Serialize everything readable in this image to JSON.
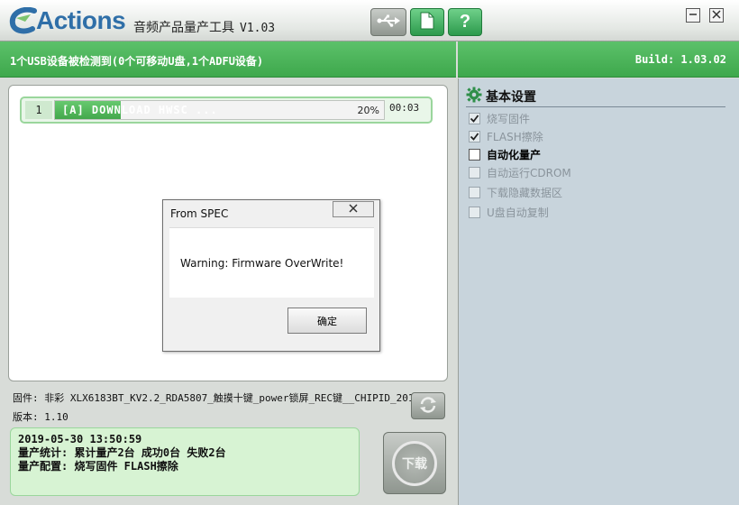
{
  "header": {
    "brand": "Actions",
    "title": "音频产品量产工具",
    "version": "V1.03",
    "help_label": "?",
    "icons": {
      "usb": "usb-icon",
      "doc": "document-icon",
      "minimize": "minimize-icon",
      "close": "close-icon"
    }
  },
  "status_strip": {
    "detected_text": "1个USB设备被检测到(0个可移动U盘,1个ADFU设备)",
    "build_text": "Build: 1.03.02"
  },
  "device": {
    "index": "1",
    "status": "[A] DOWNLOAD HWSC ...",
    "progress_label": "20%",
    "progress_value": 0.2,
    "elapsed": "00:03"
  },
  "dialog": {
    "title": "From SPEC",
    "message": "Warning: Firmware OverWrite!",
    "ok_label": "确定"
  },
  "firmware": {
    "name_line": "固件: 非彩 XLX6183BT_KV2.2_RDA5807_触摸十键_power锁屏_REC键__CHIPID_201",
    "version_line": "版本: 1.10"
  },
  "log": {
    "lines": [
      "2019-05-30 13:50:59",
      "量产统计: 累计量产2台 成功0台 失败2台",
      "量产配置: 烧写固件 FLASH擦除"
    ]
  },
  "download_label": "下载",
  "settings": {
    "title": "基本设置",
    "options": [
      {
        "label": "烧写固件",
        "checked": true,
        "enabled": false
      },
      {
        "label": "FLASH擦除",
        "checked": true,
        "enabled": false
      },
      {
        "label": "自动化量产",
        "checked": false,
        "enabled": true
      },
      {
        "label": "自动运行CDROM",
        "checked": false,
        "enabled": false
      },
      {
        "label": "下载隐藏数据区",
        "checked": false,
        "enabled": false
      },
      {
        "label": "U盘自动复制",
        "checked": false,
        "enabled": false
      }
    ]
  },
  "colors": {
    "accent_green": "#43a84c",
    "brand_blue": "#2f6fa8",
    "settings_bg": "#c8d4dc"
  }
}
